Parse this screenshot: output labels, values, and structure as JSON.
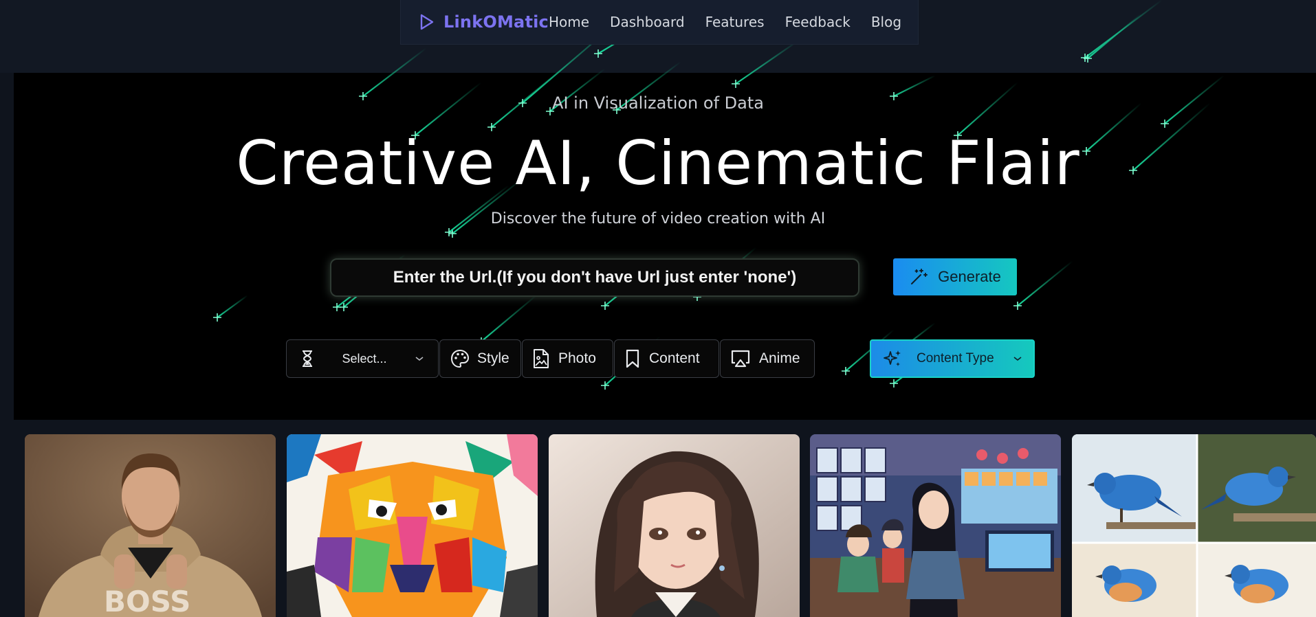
{
  "nav": {
    "brand": "LinkOMatic",
    "links": [
      "Home",
      "Dashboard",
      "Features",
      "Feedback",
      "Blog"
    ]
  },
  "hero": {
    "kicker": "AI in Visualization of Data",
    "headline": "Creative AI, Cinematic Flair",
    "subline": "Discover the future of video creation with AI",
    "url_placeholder": "Enter the Url.(If you don't have Url just enter 'none')",
    "generate_label": "Generate"
  },
  "filters": {
    "duration_select": "Select...",
    "style": "Style",
    "photo": "Photo",
    "content": "Content",
    "anime": "Anime",
    "content_type": "Content Type"
  },
  "gallery": {
    "items": [
      {
        "subject": "man-in-hoodie"
      },
      {
        "subject": "colorful-tiger"
      },
      {
        "subject": "anime-girl"
      },
      {
        "subject": "anime-artist-studio"
      },
      {
        "subject": "watercolor-bluebirds"
      }
    ]
  },
  "colors": {
    "accent_start": "#1a8cf0",
    "accent_end": "#15c7c0",
    "brand": "#7c73f0",
    "meteor": "#19e6a4"
  }
}
